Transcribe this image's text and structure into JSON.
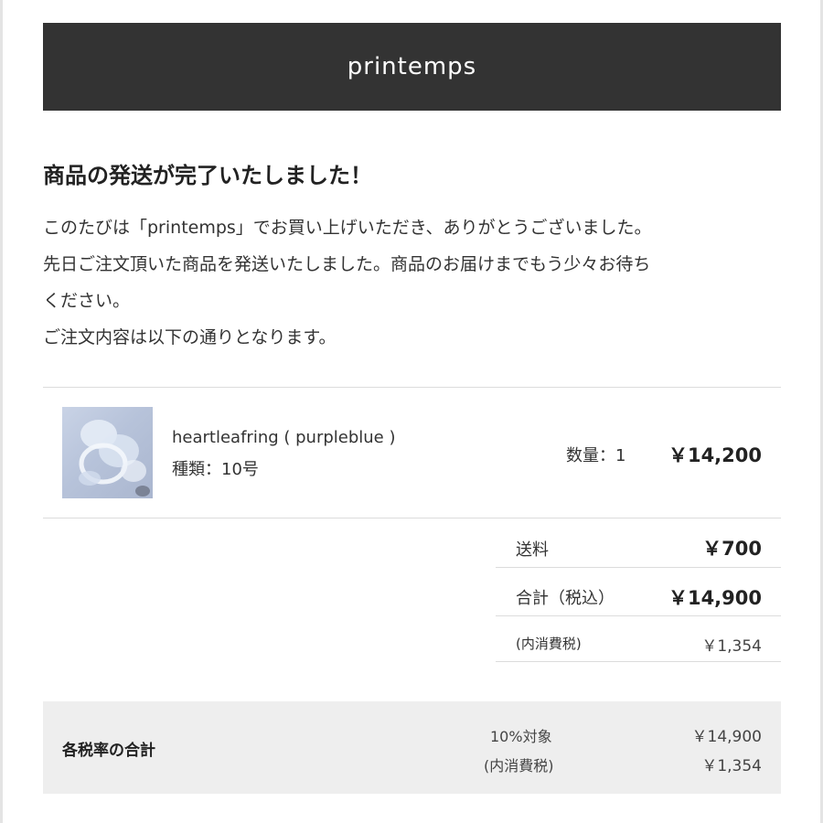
{
  "header": {
    "title": "printemps"
  },
  "headline": "商品の発送が完了いたしました！",
  "body_lines": [
    "このたびは「printemps」でお買い上げいただき、ありがとうございました。",
    "先日ご注文頂いた商品を発送いたしました。商品のお届けまでもう少々お待ち",
    "ください。",
    "ご注文内容は以下の通りとなります。"
  ],
  "order_item": {
    "image_icon": "product-photo-ring",
    "name": "heartleafring ( purpleblue )",
    "variant": "種類：10号",
    "quantity": "数量：1",
    "price": "￥14,200"
  },
  "summary": {
    "shipping_label": "送料",
    "shipping_value": "￥700",
    "total_label": "合計（税込）",
    "total_value": "￥14,900",
    "tax_label": "(内消費税)",
    "tax_value": "￥1,354"
  },
  "tax_breakdown": {
    "title": "各税率の合計",
    "rate_label": "10%対象",
    "rate_value": "￥14,900",
    "tax_label": "(内消費税)",
    "tax_value": "￥1,354"
  },
  "colors": {
    "header_bg": "#333333",
    "header_text": "#ffffff",
    "tax_box_bg": "#eeeeee",
    "rule": "#dcdcdc"
  }
}
